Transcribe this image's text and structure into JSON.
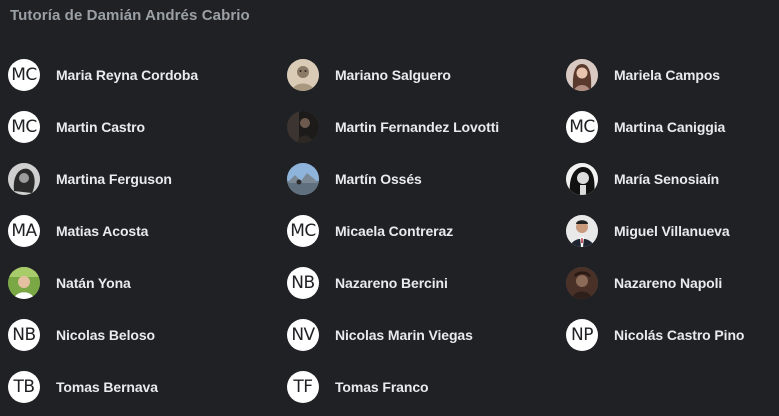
{
  "page": {
    "title": "Tutoría de Damián Andrés Cabrio"
  },
  "colors": {
    "background": "#202124",
    "title": "#9aa0a6",
    "name": "#e8eaed",
    "avatar_background": "#ffffff"
  },
  "members": [
    {
      "name": "Maria Reyna Cordoba",
      "initials": "MC",
      "avatar": "initials"
    },
    {
      "name": "Mariano Salguero",
      "avatar": "photo",
      "icon": "photo-avatar-beige"
    },
    {
      "name": "Mariela Campos",
      "avatar": "photo",
      "icon": "photo-avatar-woman"
    },
    {
      "name": "Martin Castro",
      "initials": "MC",
      "avatar": "initials"
    },
    {
      "name": "Martin Fernandez Lovotti",
      "avatar": "photo",
      "icon": "photo-avatar-dark"
    },
    {
      "name": "Martina Caniggia",
      "initials": "MC",
      "avatar": "initials"
    },
    {
      "name": "Martina Ferguson",
      "avatar": "photo",
      "icon": "photo-avatar-bw"
    },
    {
      "name": "Martín Ossés",
      "avatar": "photo",
      "icon": "photo-avatar-landscape"
    },
    {
      "name": "María Senosiaín",
      "avatar": "photo",
      "icon": "photo-avatar-bw-portrait"
    },
    {
      "name": "Matias Acosta",
      "initials": "MA",
      "avatar": "initials"
    },
    {
      "name": "Micaela Contreraz",
      "initials": "MC",
      "avatar": "initials"
    },
    {
      "name": "Miguel Villanueva",
      "avatar": "photo",
      "icon": "photo-avatar-suit"
    },
    {
      "name": "Natán Yona",
      "avatar": "photo",
      "icon": "photo-avatar-green"
    },
    {
      "name": "Nazareno Bercini",
      "initials": "NB",
      "avatar": "initials"
    },
    {
      "name": "Nazareno Napoli",
      "avatar": "photo",
      "icon": "photo-avatar-brown"
    },
    {
      "name": "Nicolas Beloso",
      "initials": "NB",
      "avatar": "initials"
    },
    {
      "name": "Nicolas Marin Viegas",
      "initials": "NV",
      "avatar": "initials"
    },
    {
      "name": "Nicolás Castro Pino",
      "initials": "NP",
      "avatar": "initials"
    },
    {
      "name": "Tomas Bernava",
      "initials": "TB",
      "avatar": "initials"
    },
    {
      "name": "Tomas Franco",
      "initials": "TF",
      "avatar": "initials"
    }
  ]
}
